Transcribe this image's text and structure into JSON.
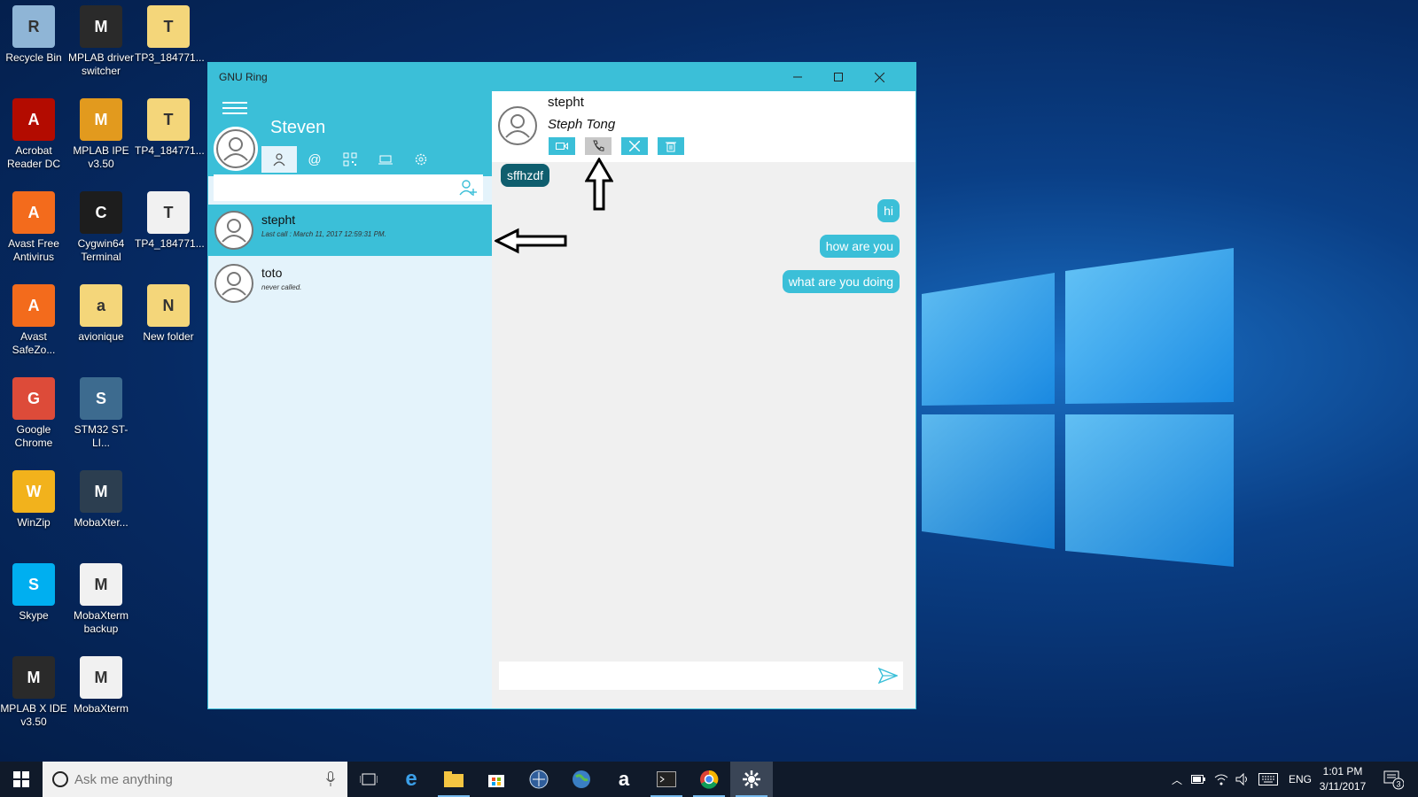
{
  "desktop": {
    "icons": [
      {
        "label": "Recycle Bin",
        "icon": "recycle-bin-icon",
        "color": "#8fb5d6"
      },
      {
        "label": "MPLAB driver switcher",
        "icon": "mplab-driver-icon",
        "color": "#2a2a2a"
      },
      {
        "label": "TP3_184771...",
        "icon": "folder-file-icon",
        "color": "#f4d67a"
      },
      {
        "label": "Acrobat Reader DC",
        "icon": "acrobat-icon",
        "color": "#b30b00"
      },
      {
        "label": "MPLAB IPE v3.50",
        "icon": "mplab-ipe-icon",
        "color": "#e29a1e"
      },
      {
        "label": "TP4_184771...",
        "icon": "folder-file-icon",
        "color": "#f4d67a"
      },
      {
        "label": "Avast Free Antivirus",
        "icon": "avast-icon",
        "color": "#f36b1c"
      },
      {
        "label": "Cygwin64 Terminal",
        "icon": "cygwin-icon",
        "color": "#1d1d1d"
      },
      {
        "label": "TP4_184771...",
        "icon": "winzip-file-icon",
        "color": "#f1f1f1"
      },
      {
        "label": "Avast SafeZo...",
        "icon": "avast-safezone-icon",
        "color": "#f36b1c"
      },
      {
        "label": "avionique",
        "icon": "folder-icon",
        "color": "#f4d67a"
      },
      {
        "label": "New folder",
        "icon": "folder-icon",
        "color": "#f4d67a"
      },
      {
        "label": "Google Chrome",
        "icon": "chrome-icon",
        "color": "#dd4b39"
      },
      {
        "label": "STM32 ST-LI...",
        "icon": "stlink-icon",
        "color": "#3d6b8f"
      },
      {
        "label": "WinZip",
        "icon": "winzip-icon",
        "color": "#f2b21c"
      },
      {
        "label": "MobaXter...",
        "icon": "mobaxterm-icon",
        "color": "#2c3e50"
      },
      {
        "label": "Skype",
        "icon": "skype-icon",
        "color": "#00aff0"
      },
      {
        "label": "MobaXterm backup",
        "icon": "winzip-file-icon",
        "color": "#f1f1f1"
      },
      {
        "label": "MPLAB X IDE v3.50",
        "icon": "mplab-x-icon",
        "color": "#2a2a2a"
      },
      {
        "label": "MobaXterm",
        "icon": "settings-file-icon",
        "color": "#f1f1f1"
      }
    ]
  },
  "window": {
    "title": "GNU Ring",
    "accent": "#3bbfd8"
  },
  "account": {
    "name": "Steven"
  },
  "search": {
    "placeholder": ""
  },
  "contacts": [
    {
      "name": "stepht",
      "sub": "Last call : March 11, 2017 12:59:31 PM.",
      "selected": true
    },
    {
      "name": "toto",
      "sub": "never called.",
      "selected": false
    }
  ],
  "conversation": {
    "name": "stepht",
    "alias": "Steph Tong",
    "messages": [
      {
        "text": "sffhzdf",
        "direction": "in"
      },
      {
        "text": "hi",
        "direction": "out"
      },
      {
        "text": "how are you",
        "direction": "out"
      },
      {
        "text": "what are you doing",
        "direction": "out"
      }
    ],
    "input_placeholder": ""
  },
  "taskbar": {
    "search_placeholder": "Ask me anything",
    "language": "ENG",
    "time": "1:01 PM",
    "date": "3/11/2017",
    "notifications": "3"
  }
}
